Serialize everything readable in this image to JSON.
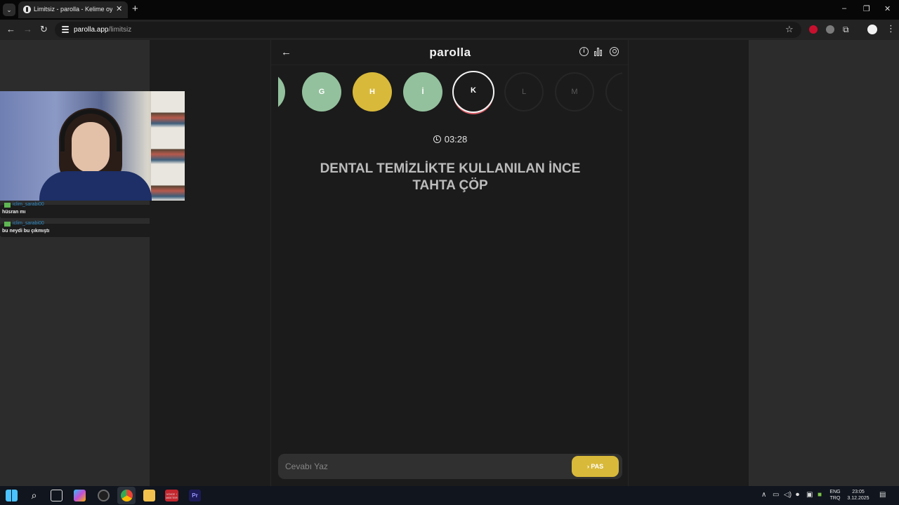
{
  "browser": {
    "tab_title": "Limitsiz - parolla - Kelime oyunu",
    "url_host": "parolla.app",
    "url_path": "/limitsiz",
    "new_tab": "+",
    "close": "✕",
    "minimize": "–",
    "restore": "❐",
    "win_close": "✕"
  },
  "game": {
    "logo": "parolla",
    "timer": "03:28",
    "question": "DENTAL TEMİZLİKTE KULLANILAN İNCE TAHTA ÇÖP",
    "letters": [
      {
        "letter": "",
        "state": "correct"
      },
      {
        "letter": "G",
        "state": "correct"
      },
      {
        "letter": "H",
        "state": "skipped"
      },
      {
        "letter": "İ",
        "state": "correct"
      },
      {
        "letter": "K",
        "state": "current"
      },
      {
        "letter": "L",
        "state": "pending"
      },
      {
        "letter": "M",
        "state": "pending"
      },
      {
        "letter": "",
        "state": "pending"
      }
    ],
    "answer_placeholder": "Cevabı Yaz",
    "pass_label": "PAS"
  },
  "chat": [
    {
      "user": "iclim_sarabi00",
      "text": "hüsran mı"
    },
    {
      "user": "iclim_sarabi00",
      "text": "bu neydi bu çıkmıştı"
    }
  ],
  "taskbar": {
    "lang_top": "ENG",
    "lang_bottom": "TRQ",
    "time": "23:05",
    "date": "3.12.2025",
    "app_label": "VOICE ↑ MEETER"
  },
  "colors": {
    "correct": "#93c19d",
    "skipped": "#d8b93a",
    "current_ring": "#d65b64",
    "accent": "#d8b93a"
  }
}
